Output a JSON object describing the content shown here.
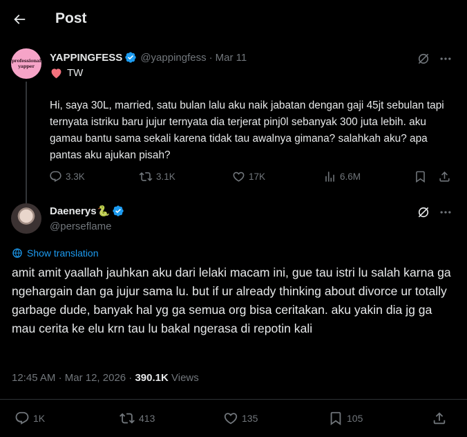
{
  "header": {
    "title": "Post"
  },
  "tweet1": {
    "avatar_text": [
      "professional",
      "yapper"
    ],
    "name": "YAPPINGFESS",
    "handle": "@yappingfess",
    "date": "Mar 11",
    "tag": "TW",
    "text": "Hi, saya 30L, married, satu bulan lalu aku naik jabatan dengan gaji 45jt sebulan tapi ternyata istriku baru jujur ternyata dia terjerat pinj0l sebanyak 300 juta lebih. aku gamau bantu sama sekali karena tidak tau awalnya gimana? salahkah aku? apa pantas aku ajukan pisah?",
    "replies": "3.3K",
    "reposts": "3.1K",
    "likes": "17K",
    "views": "6.6M"
  },
  "tweet2": {
    "name": "Daenerys",
    "name_emoji": "🐍",
    "handle": "@perseflame",
    "show_translation": "Show translation",
    "text": "amit amit yaallah jauhkan aku dari lelaki macam ini, gue tau istri lu salah karna ga ngehargain dan ga jujur sama lu. but if ur already thinking about divorce ur totally garbage dude, banyak hal yg ga semua org bisa ceritakan. aku yakin dia jg ga mau cerita ke elu krn tau lu bakal ngerasa di repotin kali",
    "time": "12:45 AM",
    "date": "Mar 12, 2026",
    "views_count": "390.1K",
    "views_label": "Views",
    "replies": "1K",
    "reposts": "413",
    "likes": "135",
    "bookmarks": "105"
  },
  "colors": {
    "background": "#000000",
    "text": "#e7e9ea",
    "muted": "#71767b",
    "accent": "#1d9bf0",
    "heart": "#f4727e",
    "gold_badge_avatar": "#f6a4c8"
  },
  "icons": {
    "back": "arrow-left-icon",
    "verified": "verified-badge-icon",
    "grok": "grok-icon",
    "more": "more-horizontal-icon",
    "reply": "reply-icon",
    "repost": "repost-icon",
    "like": "heart-icon",
    "views": "views-chart-icon",
    "bookmark": "bookmark-icon",
    "share": "share-icon",
    "translate": "globe-icon"
  }
}
